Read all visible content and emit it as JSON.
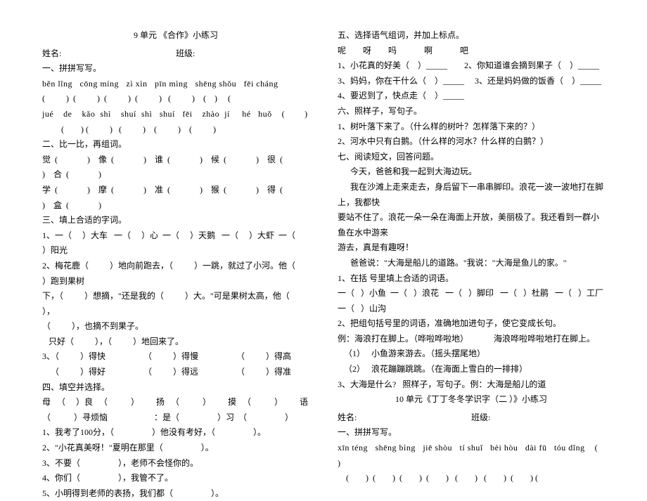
{
  "left": {
    "title": "9 单元 《合作》小练习",
    "name_label": "姓名:",
    "class_label": "班级:",
    "sec1_heading": "一、拼拼写写。",
    "pinyin1": "běn lǐng   cōng míng   zì xìn   pīn mìng   shēng shǒu   fēi cháng",
    "blanks1": "(          )  (          )  (          )  (          )   (          )    (    )     (",
    "pinyin2": "jué    de    kǎo  shì    shuí  shì   shuí   fēi    zhào  jí     hé   huǒ    (        )",
    "blanks2": "         (        ) (          )   (          )    (          )    (          )",
    "sec2_heading": "二、比一比，再组词。",
    "cmp1": "觉  (              )    像  (              )    谁  (              )    候  (              )    很  (              )    合  (              )",
    "cmp2": "学  (              )    摩  (              )    准  (              )    猴  (              )    得  (              )    盒  (              )",
    "sec3_heading": "三、填上合适的字词。",
    "s3l1": "1、一（     ）大车   一（     ）心  一（     ）天鹅   一（     ）大虾  一（     ）阳光",
    "s3l2": "2、梅花鹿（          ）地向前跑去，（          ）一跳，就过了小河。他（          ）跑到果树",
    "s3l3": "下，（          ）想摘，\"还是我的（          ）大。\"可是果树太高，他（          ），",
    "s3l4": "（          ），也摘不到果子。",
    "s3l5": "   只好（          ），（          ）地回来了。",
    "s3l6": "3、（          ）得快                  （          ）得慢                  （          ）得高",
    "s3l7": "    （          ）得好                  （          ）得远                  （          ）得准",
    "sec4_heading": "四、填空并选择。",
    "s4l1": "母   （     ）良   （           ）        扬   （           ）        摸   （           ）        语",
    "s4l2": "（           ）寻烦恼                      ：是（                  ）习  （                  ）",
    "s4l3": "1、我考了100分，（                  ）他没有考好，（                  ）。",
    "s4l4": "2、\"小花真美呀！\"夏明在那里（                  ）。",
    "s4l5": "3、不要（                  ），老师不会怪你的。",
    "s4l6": "4、你们（                  ），我管不了。",
    "s4l7": "5、小明得到老师的表扬，我们都（                  ）。"
  },
  "right": {
    "sec5_heading": "五、选择语气组词，并加上标点。",
    "s5l0": "呢        呀        吗             啊             吧",
    "s5l1": "1、小花真的好美（    ）_____        2、你知道谁会摘到果子（    ）_____",
    "s5l2": "3、妈妈，你在干什么（    ）_____     3、还是妈妈做的饭香（    ）_____",
    "s5l3": "4、要迟到了，快点走（    ）_____",
    "sec6_heading": "六、照样子，写句子。",
    "s6l1": "1、树叶落下来了。（什么样的树叶？怎样落下来的？）",
    "s6l2": "2、河水中只有白鹅。（什么样的河水？什么样的白鹅？）",
    "sec7_heading": "七、阅读短文，回答问题。",
    "p1": "      今天，爸爸和我一起到大海边玩。",
    "p2": "      我在沙滩上走来走去，身后留下一串串脚印。浪花一波一波地打在脚上，我都快",
    "p3": "要站不住了。浪花一朵一朵在海面上开放，美丽极了。我还看到一群小鱼在水中游来",
    "p4": "游去，真是有趣呀！",
    "p5": "      爸爸说：\"大海是船儿的道路。\"我说：\"大海是鱼儿的家。\"",
    "q1": "1、在括 号里填上合适的词语。",
    "q1a": "一（   ）小鱼  一（   ）浪花   一（   ）脚印   一（   ）杜鹃   一（   ）工厂   一（   ）山沟",
    "q2": "2、把组句括号里的词语，准确地加进句子，使它变成长句。",
    "q2a": "例：海浪打在脚上。（哗啦哗啦地）            海浪哗啦哗啦地打在脚上。",
    "q2b": "   （1）   小鱼游来游去。（摇头摆尾地）",
    "q2c": "   （2）   浪花蹦蹦跳跳。（在海面上雪白的一排排）",
    "q3": "3、大海是什么?   照样子，写句子。例：大海是船儿的道",
    "title2": "10 单元《丁丁冬冬学识字（二 ）》小练习",
    "name_label": "姓名:",
    "class_label": "班级:",
    "sec1b_heading": "一、拼拼写写。",
    "pinyin": "xīn téng   shēng bìng   jiē shòu   tí shuǐ   bèi hòu   dài fū   tóu dǐng    (        )",
    "blanks": "    (        )  (        )  (        )  (        )   (        )   (        )  (        ) ("
  }
}
